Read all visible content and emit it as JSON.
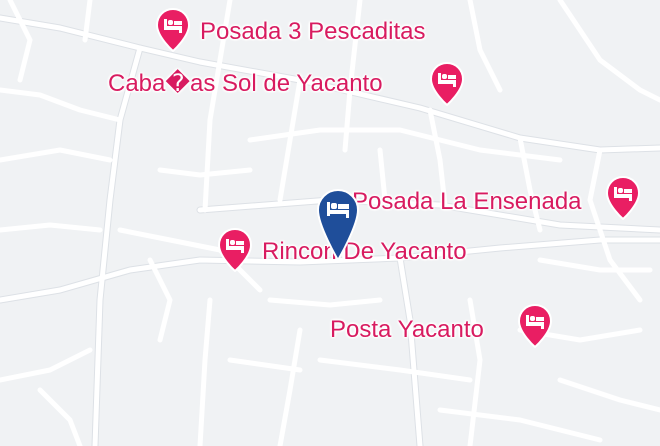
{
  "map": {
    "colors": {
      "background": "#f0f2f4",
      "road": "#ffffff",
      "poi": "#d81b60",
      "selected": "#1f4e9a"
    },
    "selected_marker": {
      "icon": "bed-icon"
    },
    "places": [
      {
        "name": "Posada 3 Pescaditas",
        "icon": "bed-icon"
      },
      {
        "name": "Caba�as Sol de Yacanto",
        "icon": "bed-icon"
      },
      {
        "name": "Posada La Ensenada",
        "icon": "bed-icon"
      },
      {
        "name": "Rincon De Yacanto",
        "icon": "bed-icon"
      },
      {
        "name": "Posta Yacanto",
        "icon": "bed-icon"
      }
    ]
  }
}
